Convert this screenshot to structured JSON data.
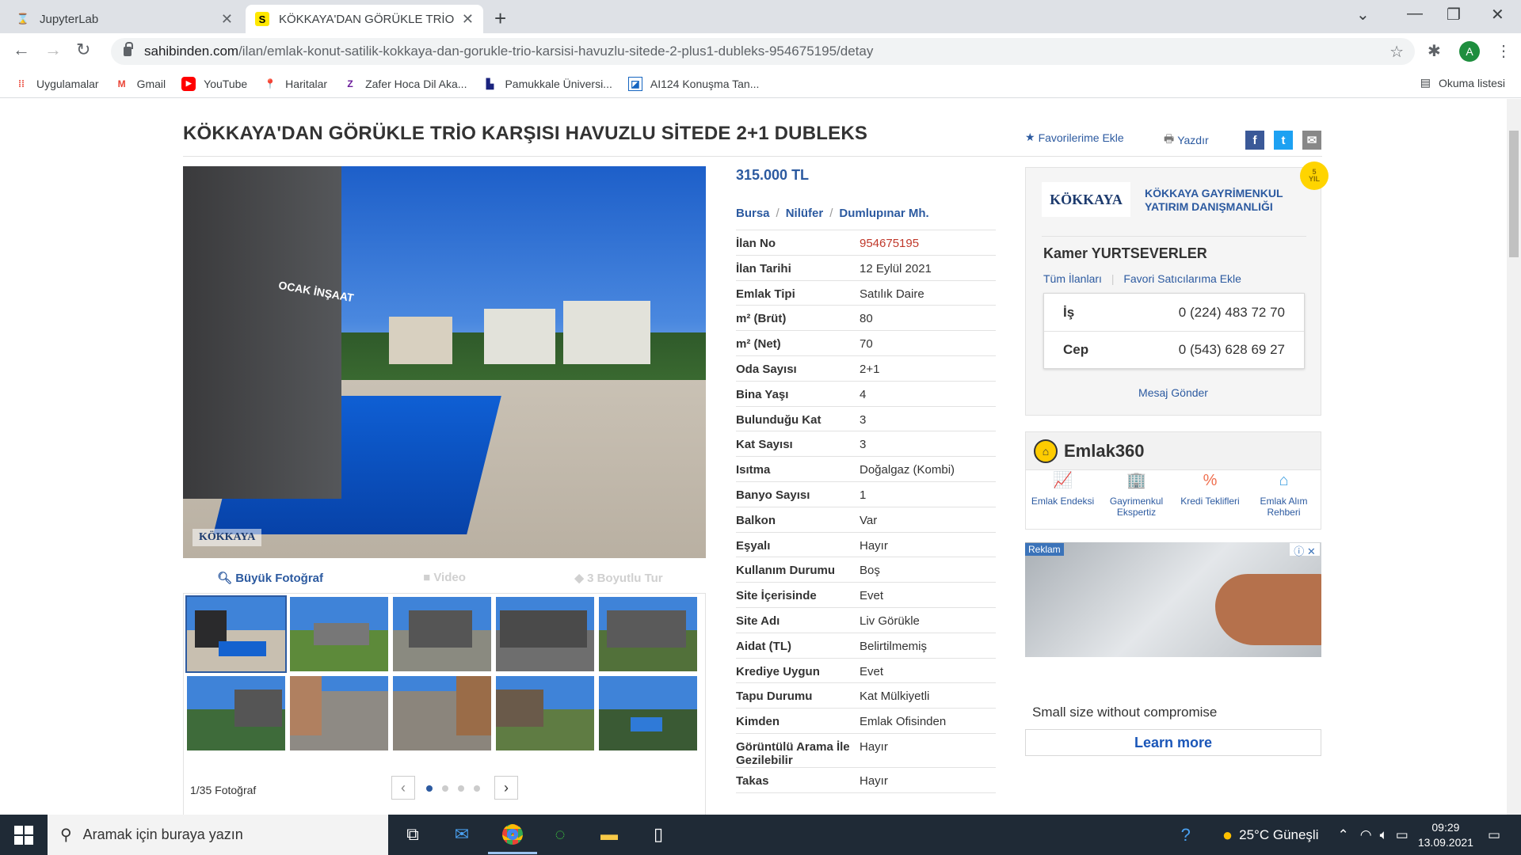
{
  "browser": {
    "tabs": [
      {
        "title": "JupyterLab",
        "active": false
      },
      {
        "title": "KÖKKAYA'DAN GÖRÜKLE TRİO KA",
        "active": true
      }
    ],
    "url_host": "sahibinden.com",
    "url_path": "/ilan/emlak-konut-satilik-kokkaya-dan-gorukle-trio-karsisi-havuzlu-sitede-2-plus1-dubleks-954675195/detay",
    "avatar_letter": "A",
    "bookmarks": [
      "Uygulamalar",
      "Gmail",
      "YouTube",
      "Haritalar",
      "Zafer Hoca Dil Aka...",
      "Pamukkale Üniversi...",
      "AI124 Konuşma Tan..."
    ],
    "reading_list": "Okuma listesi"
  },
  "listing": {
    "title": "KÖKKAYA'DAN GÖRÜKLE TRİO KARŞISI HAVUZLU SİTEDE 2+1 DUBLEKS",
    "actions": {
      "favorite": "Favorilerime Ekle",
      "print": "Yazdır"
    },
    "photo_sign": "OCAK İNŞAAT",
    "photo_logo": "KÖKKAYA",
    "media_tabs": {
      "big_photo": "Büyük Fotoğraf",
      "video": "Video",
      "tour": "3 Boyutlu Tur"
    },
    "photo_count": "1/35 Fotoğraf",
    "price": "315.000 TL",
    "location": {
      "city": "Bursa",
      "district": "Nilüfer",
      "neighborhood": "Dumlupınar Mh."
    },
    "details": [
      {
        "k": "İlan No",
        "v": "954675195"
      },
      {
        "k": "İlan Tarihi",
        "v": "12 Eylül 2021"
      },
      {
        "k": "Emlak Tipi",
        "v": "Satılık Daire"
      },
      {
        "k": "m² (Brüt)",
        "v": "80"
      },
      {
        "k": "m² (Net)",
        "v": "70"
      },
      {
        "k": "Oda Sayısı",
        "v": "2+1"
      },
      {
        "k": "Bina Yaşı",
        "v": "4"
      },
      {
        "k": "Bulunduğu Kat",
        "v": "3"
      },
      {
        "k": "Kat Sayısı",
        "v": "3"
      },
      {
        "k": "Isıtma",
        "v": "Doğalgaz (Kombi)"
      },
      {
        "k": "Banyo Sayısı",
        "v": "1"
      },
      {
        "k": "Balkon",
        "v": "Var"
      },
      {
        "k": "Eşyalı",
        "v": "Hayır"
      },
      {
        "k": "Kullanım Durumu",
        "v": "Boş"
      },
      {
        "k": "Site İçerisinde",
        "v": "Evet"
      },
      {
        "k": "Site Adı",
        "v": "Liv Görükle"
      },
      {
        "k": "Aidat (TL)",
        "v": "Belirtilmemiş"
      },
      {
        "k": "Krediye Uygun",
        "v": "Evet"
      },
      {
        "k": "Tapu Durumu",
        "v": "Kat Mülkiyetli"
      },
      {
        "k": "Kimden",
        "v": "Emlak Ofisinden"
      },
      {
        "k": "Görüntülü Arama İle Gezilebilir",
        "v": "Hayır"
      },
      {
        "k": "Takas",
        "v": "Hayır"
      }
    ]
  },
  "seller": {
    "logo": "KÖKKAYA",
    "company_line1": "KÖKKAYA GAYRİMENKUL",
    "company_line2": "YATIRIM DANIŞMANLIĞI",
    "badge_num": "5",
    "badge_word": "YIL",
    "agent": "Kamer YURTSEVERLER",
    "all_listings": "Tüm İlanları",
    "add_favorite": "Favori Satıcılarıma Ekle",
    "phone_work_label": "İş",
    "phone_work": "0 (224) 483 72 70",
    "phone_mobile_label": "Cep",
    "phone_mobile": "0 (543) 628 69 27",
    "send_message": "Mesaj Gönder"
  },
  "emlak360": {
    "name": "Emlak360",
    "items": [
      "Emlak Endeksi",
      "Gayrimenkul Ekspertiz",
      "Kredi Teklifleri",
      "Emlak Alım Rehberi"
    ]
  },
  "ad": {
    "label": "Reklam",
    "text": "Small size without compromise",
    "button": "Learn more"
  },
  "taskbar": {
    "search_placeholder": "Aramak için buraya yazın",
    "weather": "25°C Güneşli",
    "time": "09:29",
    "date": "13.09.2021"
  }
}
